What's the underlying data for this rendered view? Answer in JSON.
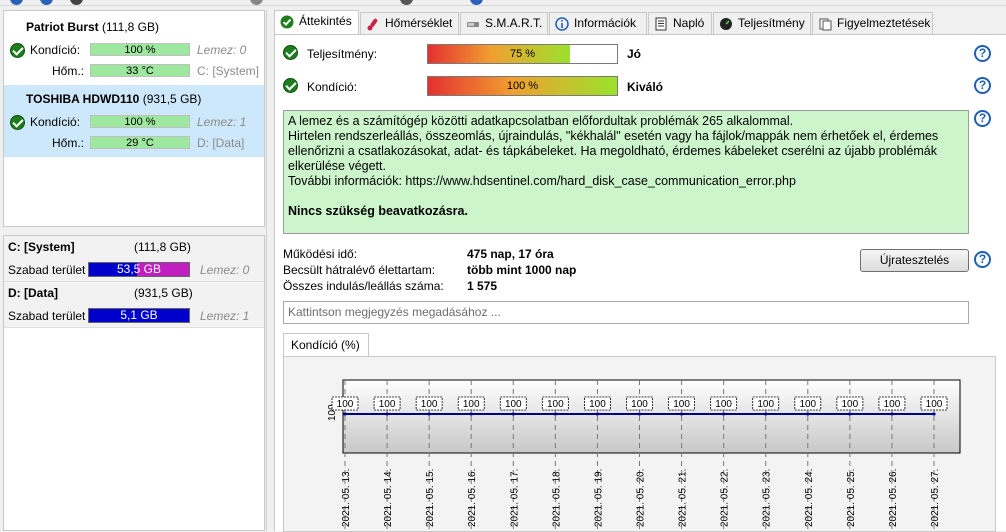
{
  "disks": [
    {
      "name": "Patriot Burst",
      "size": "(111,8 GB)",
      "health_label": "Kondíció:",
      "health_value": "100 %",
      "health_lemez": "Lemez: 0",
      "temp_label": "Hőm.:",
      "temp_value": "33 °C",
      "drive": "C: [System]"
    },
    {
      "name": "TOSHIBA HDWD110",
      "size": "(931,5 GB)",
      "health_label": "Kondíció:",
      "health_value": "100 %",
      "health_lemez": "Lemez: 1",
      "temp_label": "Hőm.:",
      "temp_value": "29 °C",
      "drive": "D: [Data]"
    }
  ],
  "volumes": [
    {
      "name": "C: [System]",
      "size": "(111,8 GB)",
      "free_label": "Szabad terület",
      "free_value": "53,5 GB",
      "lemez": "Lemez: 0",
      "free_fraction": 0.52
    },
    {
      "name": "D: [Data]",
      "size": "(931,5 GB)",
      "free_label": "Szabad terület",
      "free_value": "5,1 GB",
      "lemez": "Lemez: 1",
      "free_fraction": 0.0
    }
  ],
  "tabs": [
    {
      "label": "Áttekintés",
      "icon": "ok-icon"
    },
    {
      "label": "Hőmérséklet",
      "icon": "thermometer-icon"
    },
    {
      "label": "S.M.A.R.T.",
      "icon": "smart-icon"
    },
    {
      "label": "Információk",
      "icon": "info-icon"
    },
    {
      "label": "Napló",
      "icon": "log-icon"
    },
    {
      "label": "Teljesítmény",
      "icon": "performance-icon"
    },
    {
      "label": "Figyelmeztetések",
      "icon": "alerts-icon"
    }
  ],
  "overview": {
    "performance_label": "Teljesítmény:",
    "performance_value": "75 %",
    "performance_percent": 75,
    "performance_rating": "Jó",
    "health_label": "Kondíció:",
    "health_value": "100 %",
    "health_percent": 100,
    "health_rating": "Kiváló",
    "message_lines": [
      "A lemez és a számítógép közötti adatkapcsolatban előfordultak problémák 265 alkalommal.",
      "Hirtelen rendszerleállás, összeomlás, újraindulás, \"kékhalál\" esetén vagy ha fájlok/mappák nem érhetőek el, érdemes ellenőrizni a csatlakozásokat, adat- és tápkábeleket. Ha megoldható, érdemes kábeleket cserélni az újabb problémák elkerülése végett.",
      "További információk: https://www.hdsentinel.com/hard_disk_case_communication_error.php"
    ],
    "message_bold": "Nincs szükség beavatkozásra.",
    "uptime_label": "Működési idő:",
    "uptime_value": "475 nap, 17 óra",
    "remaining_label": "Becsült hátralévő élettartam:",
    "remaining_value": "több mint 1000 nap",
    "starts_label": "Összes indulás/leállás száma:",
    "starts_value": "1 575",
    "retest_button": "Újratesztelés",
    "note_placeholder": "Kattintson megjegyzés megadásához ...",
    "chart_tab": "Kondíció  (%)",
    "help_glyph": "?"
  },
  "chart_data": {
    "type": "line",
    "x": [
      "2021. 05. 13.",
      "2021. 05. 14.",
      "2021. 05. 15.",
      "2021. 05. 16.",
      "2021. 05. 17.",
      "2021. 05. 18.",
      "2021. 05. 19.",
      "2021. 05. 20.",
      "2021. 05. 21.",
      "2021. 05. 22.",
      "2021. 05. 23.",
      "2021. 05. 24.",
      "2021. 05. 25.",
      "2021. 05. 26.",
      "2021. 05. 27."
    ],
    "series": [
      {
        "values": [
          100,
          100,
          100,
          100,
          100,
          100,
          100,
          100,
          100,
          100,
          100,
          100,
          100,
          100,
          100
        ]
      }
    ],
    "ytick_labels": [
      "100"
    ],
    "ylim": [
      0,
      100
    ],
    "grid": true,
    "line_color": "#00008b"
  }
}
